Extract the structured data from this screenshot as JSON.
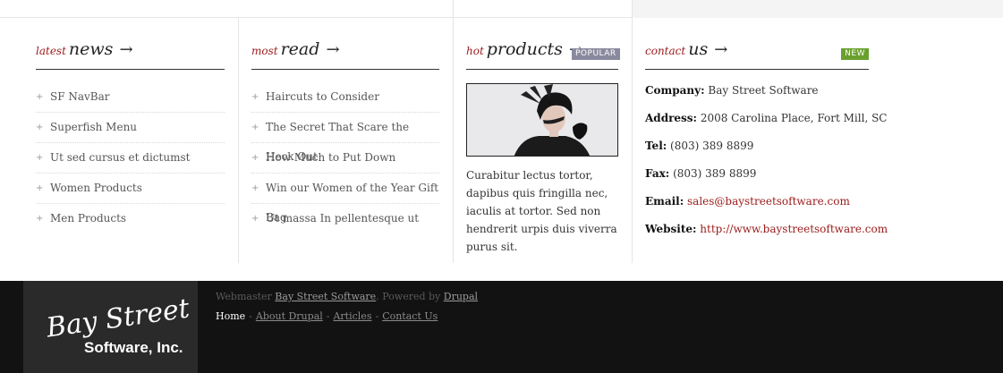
{
  "columns": {
    "news": {
      "heading_small": "latest",
      "heading_big": "news",
      "arrow": "→",
      "items": [
        "SF NavBar",
        "Superfish Menu",
        "Ut sed cursus et dictumst",
        "Women Products",
        "Men Products"
      ]
    },
    "read": {
      "heading_small": "most",
      "heading_big": "read",
      "arrow": "→",
      "items": [
        "Haircuts to Consider",
        "The Secret That Scare the Heck Out",
        "How Much to Put Down",
        "Win our Women of the Year Gift Bag",
        "Ut massa In pellentesque ut"
      ]
    },
    "products": {
      "heading_small": "hot",
      "heading_big": "products",
      "arrow": "→",
      "badge": "POPULAR",
      "description": "Curabitur lectus tortor, dapibus quis fringilla nec, iaculis at tortor. Sed non hendrerit urpis duis viverra purus sit."
    },
    "contact": {
      "heading_small": "contact",
      "heading_big": "us",
      "arrow": "→",
      "badge": "NEW",
      "company_label": "Company:",
      "company": "Bay Street Software",
      "address_label": "Address:",
      "address": "2008 Carolina Place, Fort Mill, SC",
      "tel_label": "Tel:",
      "tel": "(803) 389 8899",
      "fax_label": "Fax:",
      "fax": "(803) 389 8899",
      "email_label": "Email:",
      "email": "sales@baystreetsoftware.com",
      "website_label": "Website:",
      "website": "http://www.baystreetsoftware.com"
    }
  },
  "footer": {
    "logo_line1": "Bay Street",
    "logo_line2": "Software, Inc.",
    "webmaster_prefix": "Webmaster",
    "webmaster_link": "Bay Street Software",
    "powered_prefix": ". Powered by",
    "powered_link": "Drupal",
    "nav": [
      "Home",
      "About Drupal",
      "Articles",
      "Contact Us"
    ],
    "nav_separator": "-"
  },
  "colors": {
    "accent": "#9b1a1a",
    "badge_popular": "#8a8a9e",
    "badge_new": "#6aa02e",
    "footer_bg": "#121212"
  }
}
